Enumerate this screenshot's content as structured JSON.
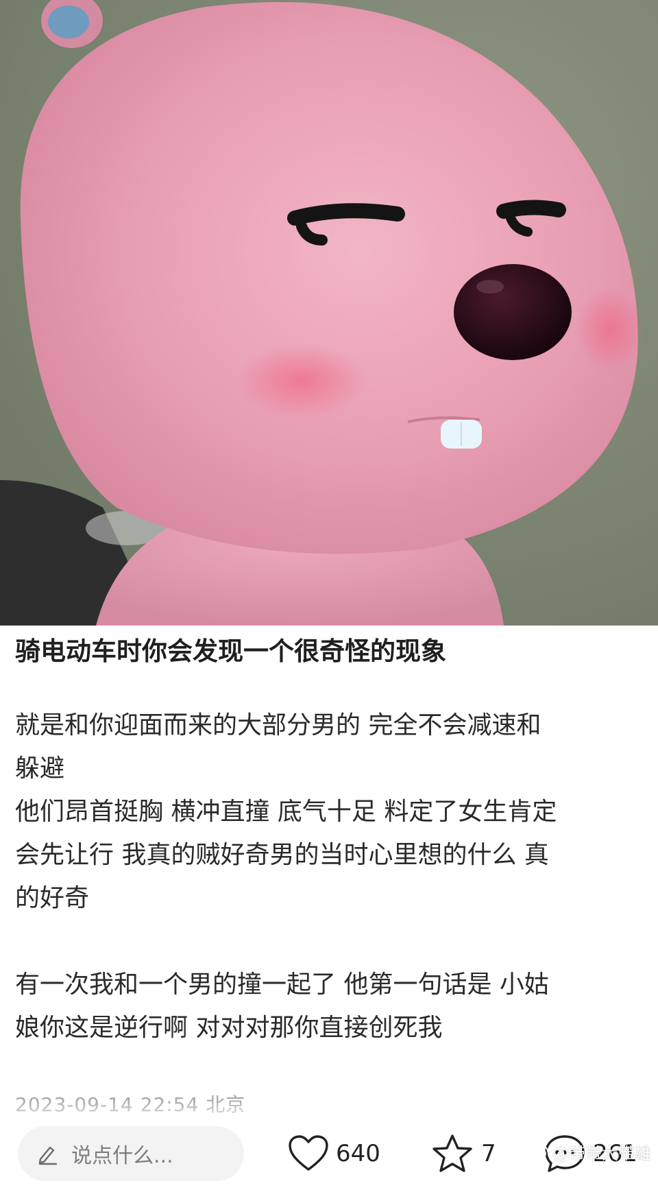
{
  "post": {
    "title": "骑电动车时你会发现一个很奇怪的现象",
    "body_lines": [
      "就是和你迎面而来的大部分男的 完全不会减速和",
      "躲避",
      "他们昂首挺胸 横冲直撞 底气十足 料定了女生肯定",
      "会先让行 我真的贼好奇男的当时心里想的什么 真",
      "的好奇",
      "",
      "有一次我和一个男的撞一起了 他第一句话是 小姑",
      "娘你这是逆行啊 对对对那你直接创死我"
    ],
    "meta": "2023-09-14 22:54 北京"
  },
  "bottom_bar": {
    "comment_placeholder": "说点什么...",
    "like_count": "640",
    "favorite_count": "7",
    "comment_count": "261"
  },
  "watermark": {
    "text": "@带带大带雄"
  },
  "icons": {
    "comment_input": "pen-icon",
    "like": "heart-icon",
    "favorite": "star-icon",
    "comment": "chat-bubble-icon",
    "watermark": "weibo-icon"
  },
  "colors": {
    "character_pink": "#e9a0b4",
    "background_olive": "#7b8371",
    "text_primary": "#1f1f1f",
    "meta_gray": "#a8a8a8"
  }
}
